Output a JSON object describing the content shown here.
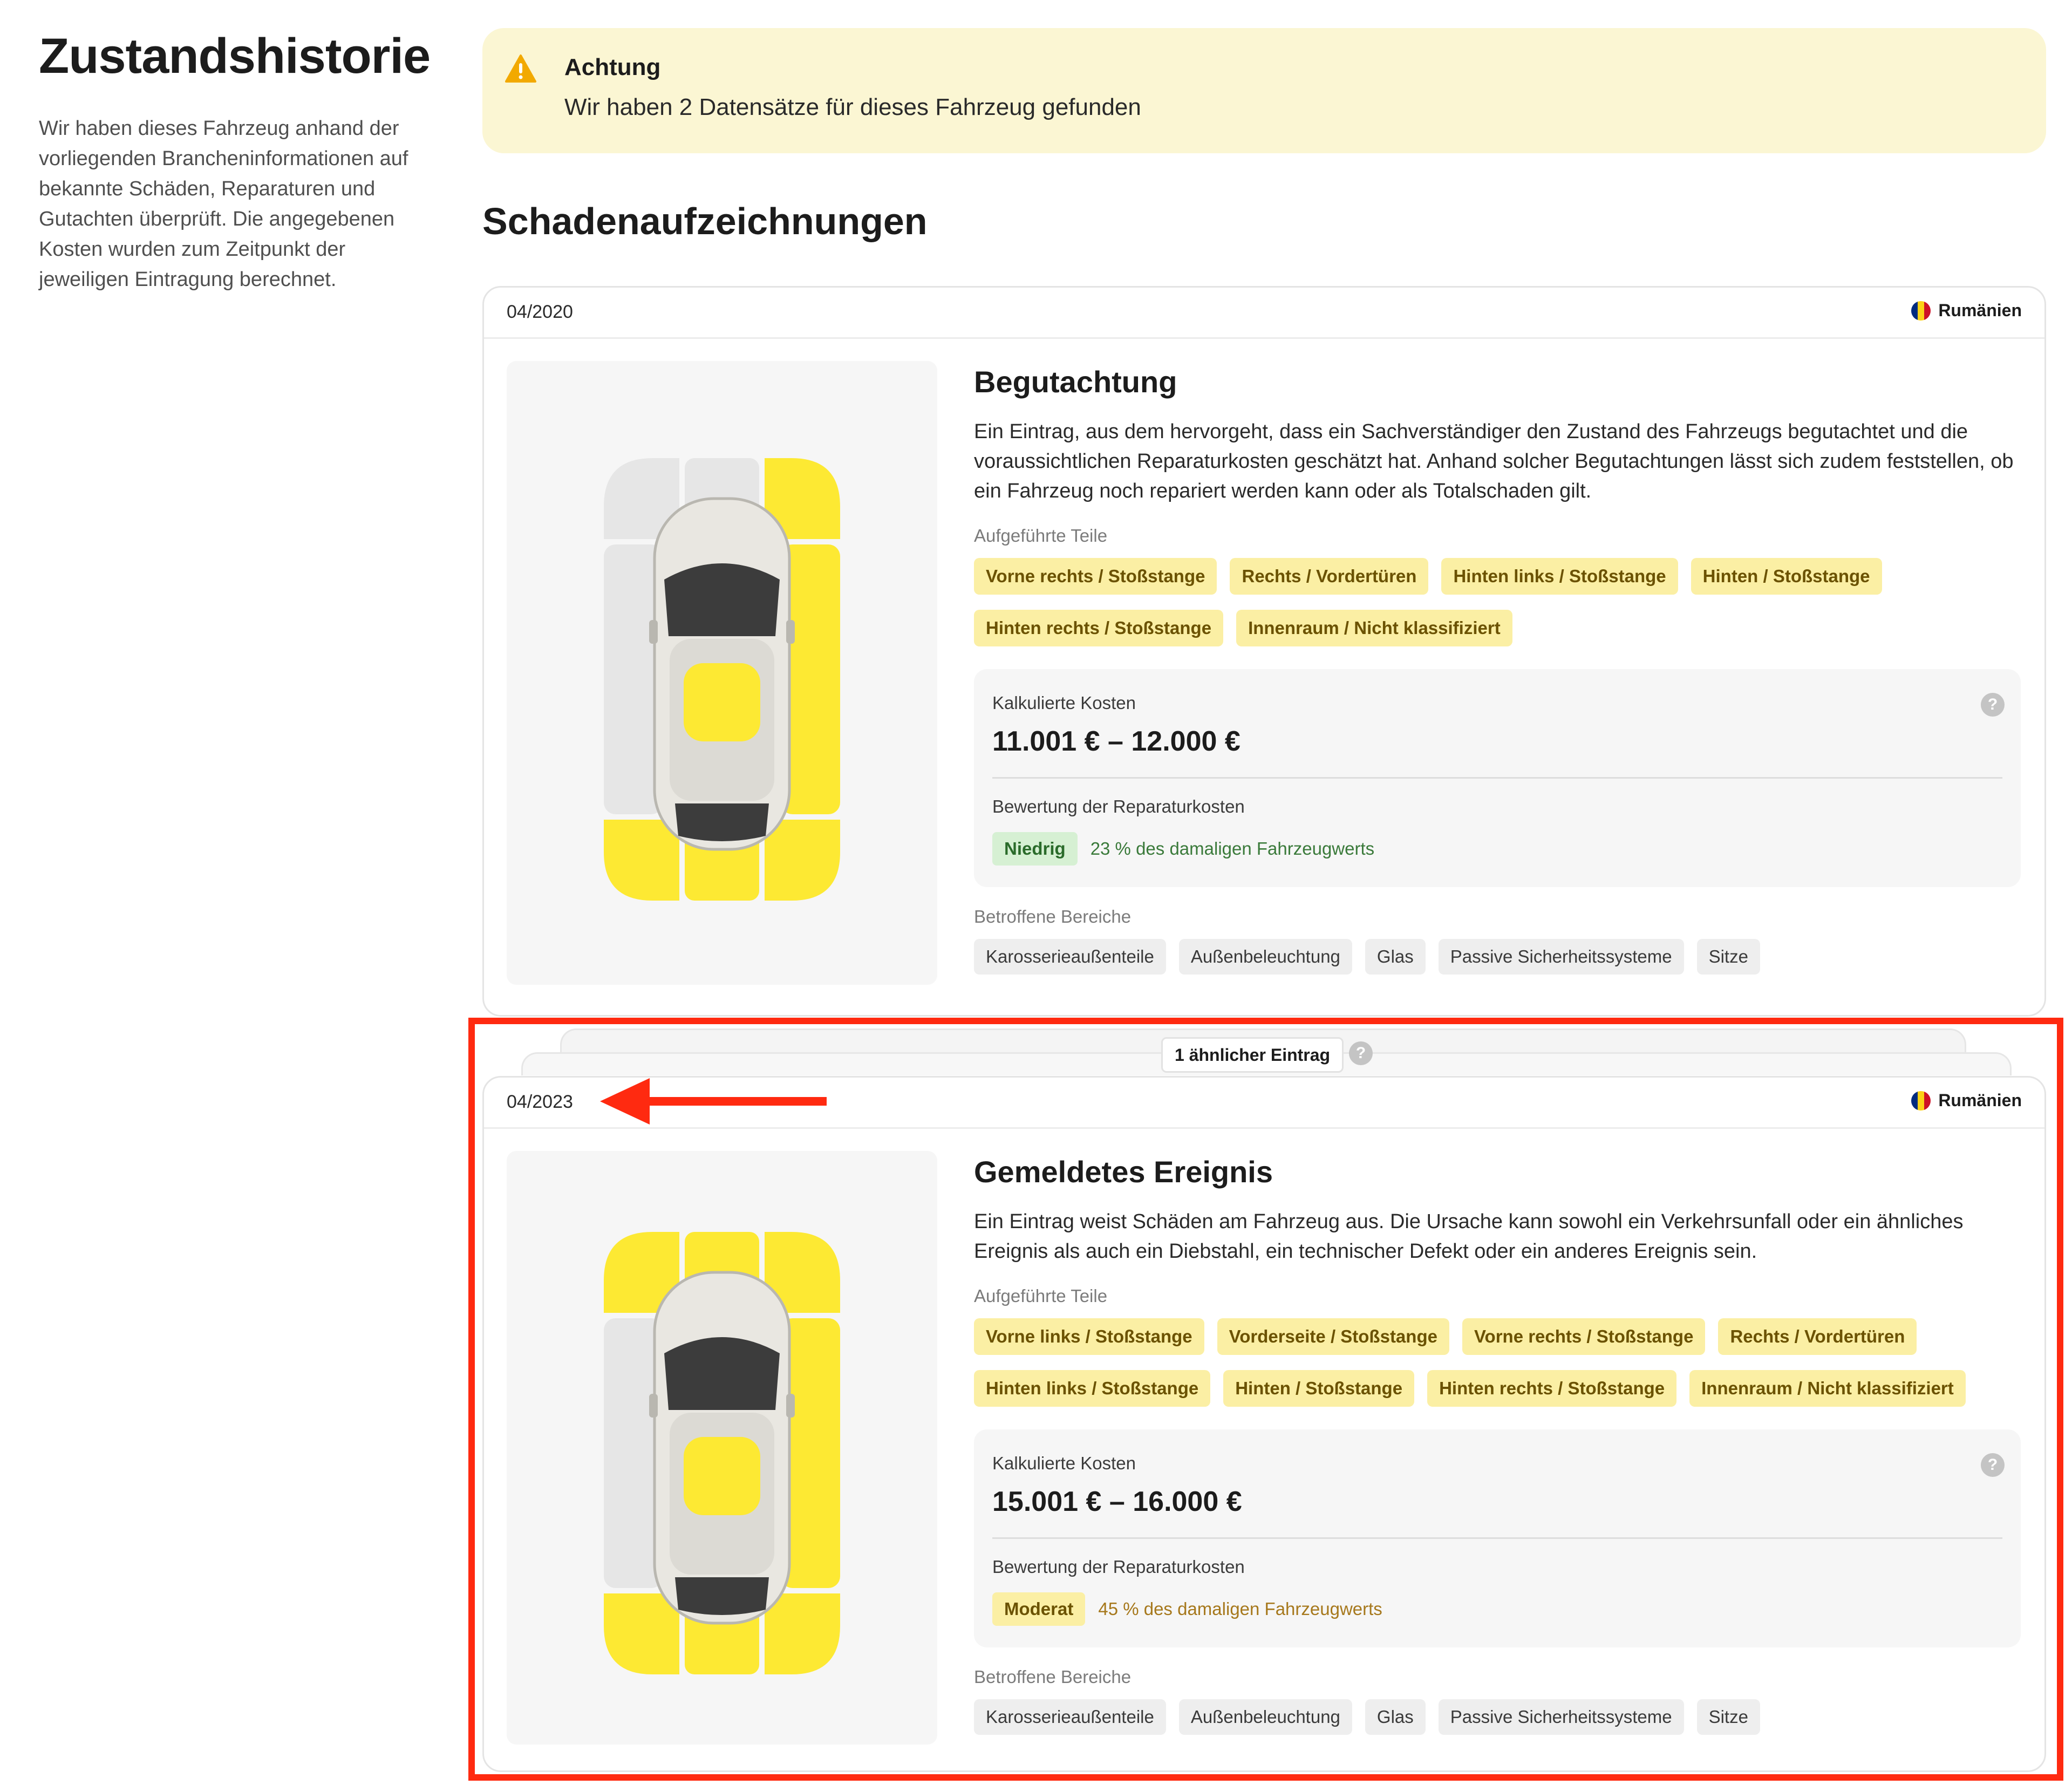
{
  "page": {
    "title": "Zustandshistorie",
    "intro": "Wir haben dieses Fahrzeug anhand der vorliegenden Brancheninformationen auf bekannte Schäden, Reparaturen und Gutachten überprüft. Die angegebenen Kosten wurden zum Zeitpunkt der jeweiligen Eintragung berechnet."
  },
  "alert": {
    "icon": "warning-icon",
    "title": "Achtung",
    "text": "Wir haben 2 Datensätze für dieses Fahrzeug gefunden"
  },
  "section_title": "Schadenaufzeichnungen",
  "labels": {
    "parts": "Aufgeführte Teile",
    "cost": "Kalkulierte Kosten",
    "rating": "Bewertung der Reparaturkosten",
    "areas": "Betroffene Bereiche"
  },
  "similar": {
    "label": "1 ähnlicher Eintrag",
    "help": "?"
  },
  "records": [
    {
      "date": "04/2020",
      "country": "Rumänien",
      "title": "Begutachtung",
      "description": "Ein Eintrag, aus dem hervorgeht, dass ein Sachverständiger den Zustand des Fahrzeugs begutachtet und die voraussichtlichen Reparaturkosten geschätzt hat. Anhand solcher Begutachtungen lässt sich zudem feststellen, ob ein Fahrzeug noch repariert werden kann oder als Totalschaden gilt.",
      "parts": [
        "Vorne rechts / Stoßstange",
        "Rechts / Vordertüren",
        "Hinten links / Stoßstange",
        "Hinten / Stoßstange",
        "Hinten rechts / Stoßstange",
        "Innenraum / Nicht klassifiziert"
      ],
      "cost": "11.001 € – 12.000 €",
      "help": "?",
      "rating": "Niedrig",
      "rating_text": "23 % des damaligen Fahrzeugwerts",
      "areas": [
        "Karosserieaußenteile",
        "Außenbeleuchtung",
        "Glas",
        "Passive Sicherheitssysteme",
        "Sitze"
      ]
    },
    {
      "date": "04/2023",
      "country": "Rumänien",
      "title": "Gemeldetes Ereignis",
      "description": "Ein Eintrag weist Schäden am Fahrzeug aus. Die Ursache kann sowohl ein Verkehrsunfall oder ein ähnliches Ereignis als auch ein Diebstahl, ein technischer Defekt oder ein anderes Ereignis sein.",
      "parts": [
        "Vorne links / Stoßstange",
        "Vorderseite / Stoßstange",
        "Vorne rechts / Stoßstange",
        "Rechts / Vordertüren",
        "Hinten links / Stoßstange",
        "Hinten / Stoßstange",
        "Hinten rechts / Stoßstange",
        "Innenraum / Nicht klassifiziert"
      ],
      "cost": "15.001 € – 16.000 €",
      "help": "?",
      "rating": "Moderat",
      "rating_text": "45 % des damaligen Fahrzeugwerts",
      "areas": [
        "Karosserieaußenteile",
        "Außenbeleuchtung",
        "Glas",
        "Passive Sicherheitssysteme",
        "Sitze"
      ]
    }
  ],
  "colors": {
    "alert_bg": "#fbf6d3",
    "damage_yellow": "#fde933",
    "zone_grey": "#e6e6e6",
    "chip_yellow": "#fbefa4",
    "highlight_red": "#ff2a10",
    "rating_low": "#d6f0d3",
    "flag": [
      "#002b7f",
      "#fcd116",
      "#ce1126"
    ]
  }
}
